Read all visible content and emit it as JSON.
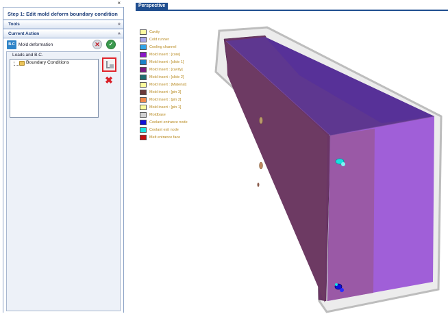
{
  "panel": {
    "step_title": "Step 1: Edit mold deform boundary condition",
    "tools_label": "Tools",
    "current_action_label": "Current Action",
    "action_icon_text": "B.C",
    "action_name": "Mold deformation",
    "group_label": "Loads and B.C.",
    "tree_item": "Boundary Conditions",
    "chevron_glyph": "«"
  },
  "viewport": {
    "tab_label": "Perspective"
  },
  "legend": [
    {
      "label": "Cavity",
      "color": "#fffba0"
    },
    {
      "label": "Cold runner",
      "color": "#a7a6ea"
    },
    {
      "label": "Cooling channel",
      "color": "#2fa3e8"
    },
    {
      "label": "Mold insert : [core]",
      "color": "#8a17c7"
    },
    {
      "label": "Mold insert : [slide 1]",
      "color": "#1c84c9"
    },
    {
      "label": "Mold insert : [cavity]",
      "color": "#7a1a7f"
    },
    {
      "label": "Mold insert : [slide 2]",
      "color": "#1d6c6e"
    },
    {
      "label": "Mold insert : [Material]",
      "color": "#fbfb9c"
    },
    {
      "label": "Mold insert : [pin 3]",
      "color": "#6b3a3a"
    },
    {
      "label": "Mold insert : [pin 2]",
      "color": "#f0884a"
    },
    {
      "label": "Mold insert : [pin 1]",
      "color": "#fbfb9c"
    },
    {
      "label": "Moldbase",
      "color": "#cfcfcf"
    },
    {
      "label": "Coolant entrance node",
      "color": "#1010d8"
    },
    {
      "label": "Coolant exit node",
      "color": "#18e0e0"
    },
    {
      "label": "Melt entrance face",
      "color": "#c41010"
    }
  ],
  "icons": {
    "close": "close-icon",
    "cancel": "cancel-icon",
    "ok": "check-icon",
    "edit": "edit-icon",
    "delete": "delete-icon",
    "folder": "folder-icon"
  }
}
